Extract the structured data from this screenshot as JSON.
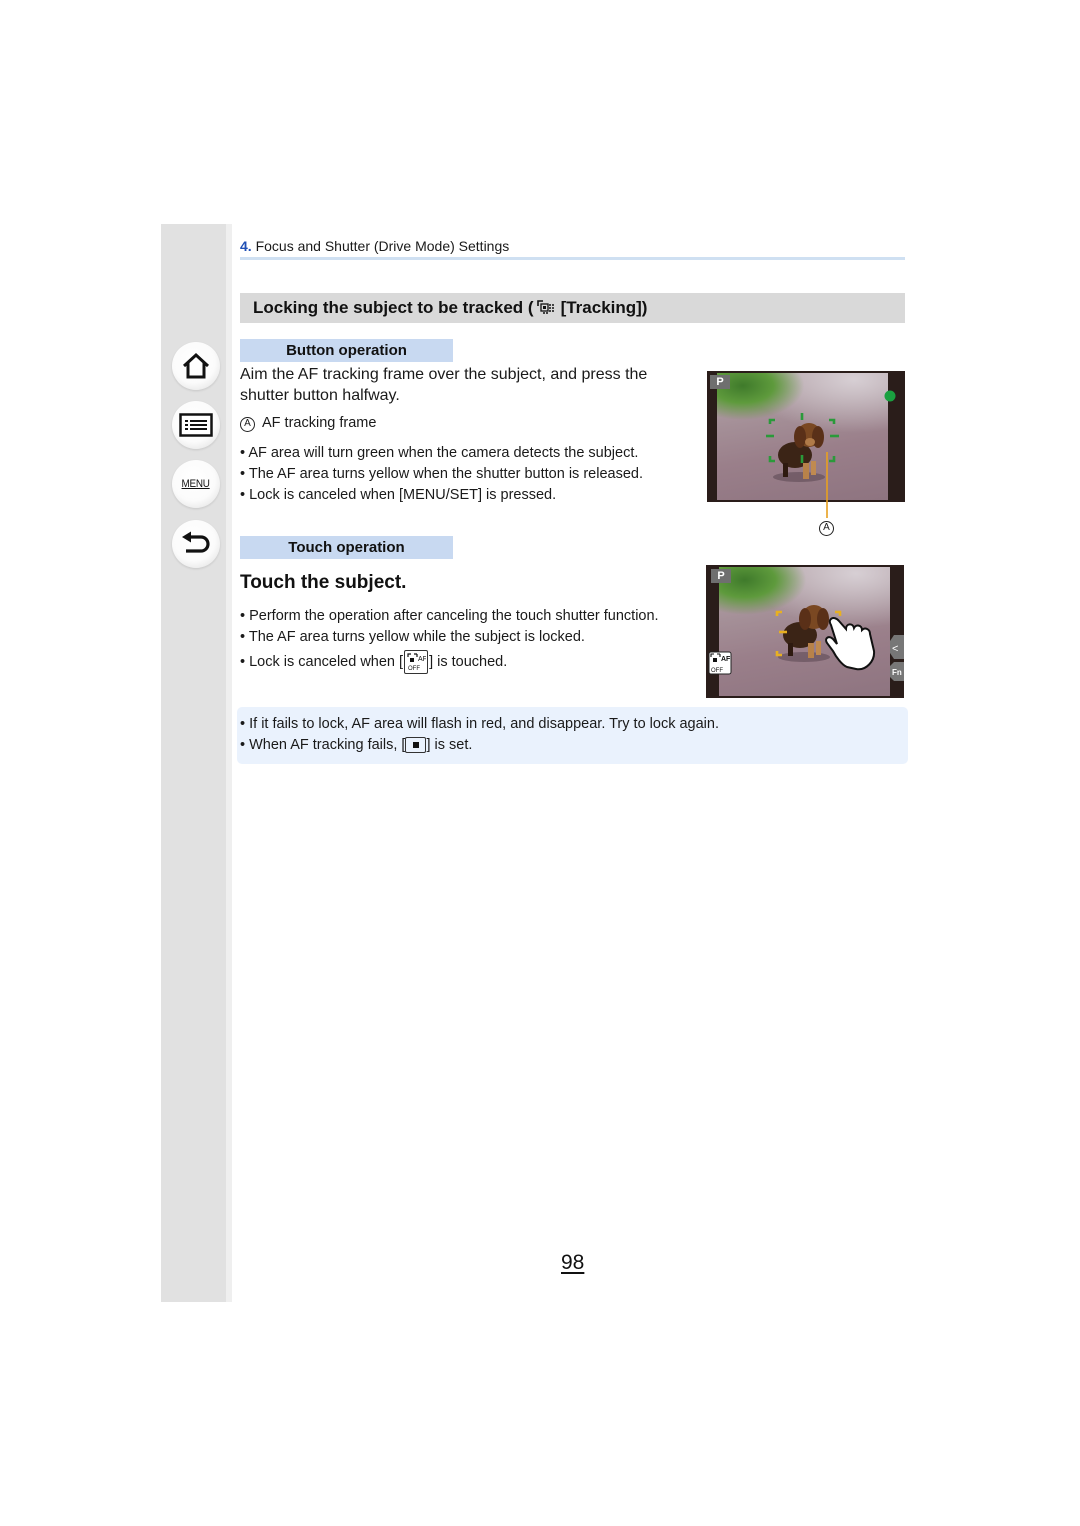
{
  "sidebar": {
    "buttons": [
      {
        "name": "home",
        "icon": "home-icon"
      },
      {
        "name": "contents",
        "icon": "list-icon"
      },
      {
        "name": "menu",
        "label": "MENU"
      },
      {
        "name": "back",
        "icon": "back-arrow-icon"
      }
    ]
  },
  "header": {
    "chapter_number": "4.",
    "chapter_title": "Focus and Shutter (Drive Mode) Settings"
  },
  "section": {
    "title_prefix": "Locking the subject to be tracked (",
    "title_icon": "tracking-af-icon",
    "title_suffix": "[Tracking])"
  },
  "button_operation": {
    "label": "Button operation",
    "instruction": "Aim the AF tracking frame over the subject, and press the shutter button halfway.",
    "callout_letter": "A",
    "callout_text": "AF tracking frame",
    "bullets": [
      "AF area will turn green when the camera detects the subject.",
      "The AF area turns yellow when the shutter button is released.",
      "Lock is canceled when [MENU/SET] is pressed."
    ],
    "screen": {
      "mode": "P",
      "focus_indicator_color": "#1aa040",
      "frame_color": "#2a9a3a",
      "callout_line_color": "#e8a020",
      "callout_letter": "A"
    }
  },
  "touch_operation": {
    "label": "Touch operation",
    "step_title": "Touch the subject.",
    "bullets": [
      "Perform the operation after canceling the touch shutter function.",
      "The AF area turns yellow while the subject is locked."
    ],
    "cancel_prefix": "Lock is canceled when [",
    "cancel_icon": "touch-af-off-icon",
    "cancel_suffix": "] is touched.",
    "screen": {
      "mode": "P",
      "frame_color": "#e8b020",
      "touch_af_label": "AF",
      "touch_af_sub": "OFF",
      "tab_arrow": "<",
      "fn_label": "Fn"
    }
  },
  "notes": {
    "bullets": [
      "If it fails to lock, AF area will flash in red, and disappear. Try to lock again."
    ],
    "fail_prefix": "When AF tracking fails, [",
    "fail_icon": "1-area-af-icon",
    "fail_suffix": "] is set."
  },
  "footer": {
    "page_number": "98"
  }
}
